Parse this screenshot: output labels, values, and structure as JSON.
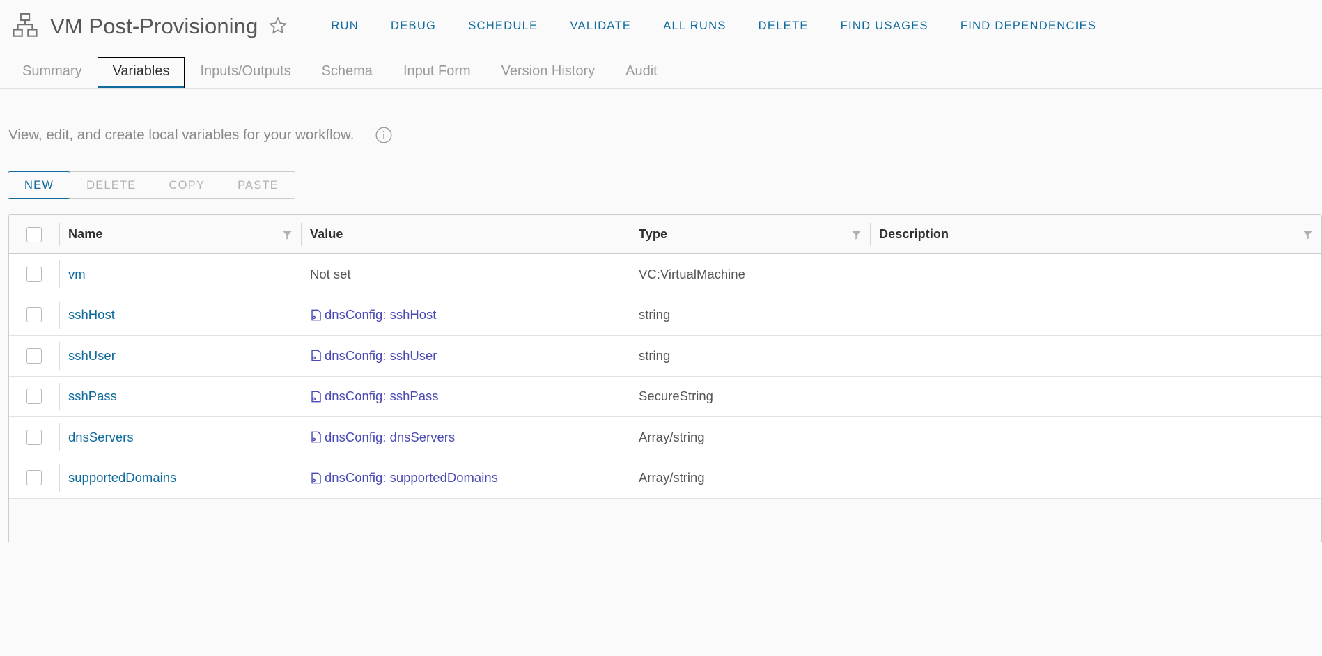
{
  "header": {
    "icon": "workflow-schema-icon",
    "title": "VM Post-Provisioning",
    "favorite_icon": "star-outline-icon",
    "actions": [
      {
        "label": "RUN"
      },
      {
        "label": "DEBUG"
      },
      {
        "label": "SCHEDULE"
      },
      {
        "label": "VALIDATE"
      },
      {
        "label": "ALL RUNS"
      },
      {
        "label": "DELETE"
      },
      {
        "label": "FIND USAGES"
      },
      {
        "label": "FIND DEPENDENCIES"
      }
    ]
  },
  "tabs": [
    {
      "label": "Summary",
      "active": false
    },
    {
      "label": "Variables",
      "active": true
    },
    {
      "label": "Inputs/Outputs",
      "active": false
    },
    {
      "label": "Schema",
      "active": false
    },
    {
      "label": "Input Form",
      "active": false
    },
    {
      "label": "Version History",
      "active": false
    },
    {
      "label": "Audit",
      "active": false
    }
  ],
  "description": {
    "text": "View, edit, and create local variables for your workflow.",
    "info_icon": "info-circle-icon"
  },
  "toolbar": {
    "buttons": [
      {
        "label": "NEW",
        "enabled": true
      },
      {
        "label": "DELETE",
        "enabled": false
      },
      {
        "label": "COPY",
        "enabled": false
      },
      {
        "label": "PASTE",
        "enabled": false
      }
    ]
  },
  "table": {
    "columns": [
      {
        "label": "Name",
        "filter": true
      },
      {
        "label": "Value",
        "filter": false
      },
      {
        "label": "Type",
        "filter": true
      },
      {
        "label": "Description",
        "filter": true
      }
    ],
    "rows": [
      {
        "selected": false,
        "name": "vm",
        "value": "Not set",
        "bound": false,
        "type": "VC:VirtualMachine",
        "description": ""
      },
      {
        "selected": false,
        "name": "sshHost",
        "value": "dnsConfig: sshHost",
        "bound": true,
        "type": "string",
        "description": ""
      },
      {
        "selected": false,
        "name": "sshUser",
        "value": "dnsConfig: sshUser",
        "bound": true,
        "type": "string",
        "description": ""
      },
      {
        "selected": false,
        "name": "sshPass",
        "value": "dnsConfig: sshPass",
        "bound": true,
        "type": "SecureString",
        "description": ""
      },
      {
        "selected": false,
        "name": "dnsServers",
        "value": "dnsConfig: dnsServers",
        "bound": true,
        "type": "Array/string",
        "description": ""
      },
      {
        "selected": false,
        "name": "supportedDomains",
        "value": "dnsConfig: supportedDomains",
        "bound": true,
        "type": "Array/string",
        "description": ""
      }
    ]
  },
  "colors": {
    "accent": "#0f6a9e",
    "binding": "#4a4ab5",
    "text": "#565656",
    "muted": "#9a9a9a"
  }
}
